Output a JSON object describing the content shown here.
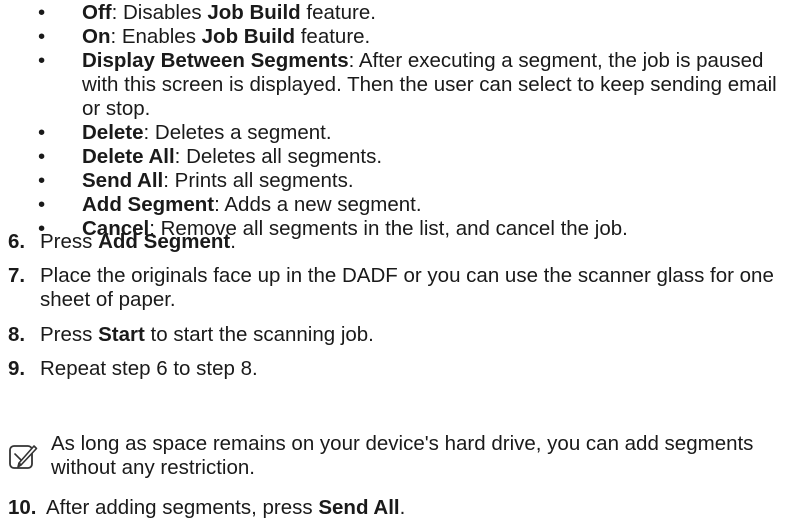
{
  "bullets": [
    {
      "term": "Off",
      "desc": ": Disables ",
      "term2": "Job Build",
      "desc2": " feature."
    },
    {
      "term": "On",
      "desc": ": Enables ",
      "term2": "Job Build",
      "desc2": " feature."
    },
    {
      "term": "Display Between Segments",
      "desc": ": After executing a segment, the job is paused with this screen is displayed. Then the user can select to keep sending email or stop."
    },
    {
      "term": "Delete",
      "desc": ": Deletes a segment."
    },
    {
      "term": "Delete All",
      "desc": ": Deletes all segments."
    },
    {
      "term": "Send All",
      "desc": ": Prints all segments."
    },
    {
      "term": "Add Segment",
      "desc": ": Adds a new segment."
    },
    {
      "term": "Cancel",
      "desc": ": Remove all segments in the list, and cancel the job."
    }
  ],
  "bullet_symbol": "•",
  "steps": {
    "s6": {
      "num": "6.",
      "pre": "Press ",
      "bold": "Add Segment",
      "post": "."
    },
    "s7": {
      "num": "7.",
      "text": "Place the originals face up in the DADF or you can use the scanner glass for one sheet of paper."
    },
    "s8": {
      "num": "8.",
      "pre": "Press ",
      "bold": "Start",
      "post": " to start the scanning job."
    },
    "s9": {
      "num": "9.",
      "text": "Repeat step 6 to step 8."
    },
    "s10": {
      "num": "10.",
      "pre": "After adding segments, press ",
      "bold": "Send All",
      "post": "."
    }
  },
  "note": {
    "icon": "note-pencil-icon",
    "text": "As long as space remains on your device's hard drive, you can add segments without any restriction."
  }
}
